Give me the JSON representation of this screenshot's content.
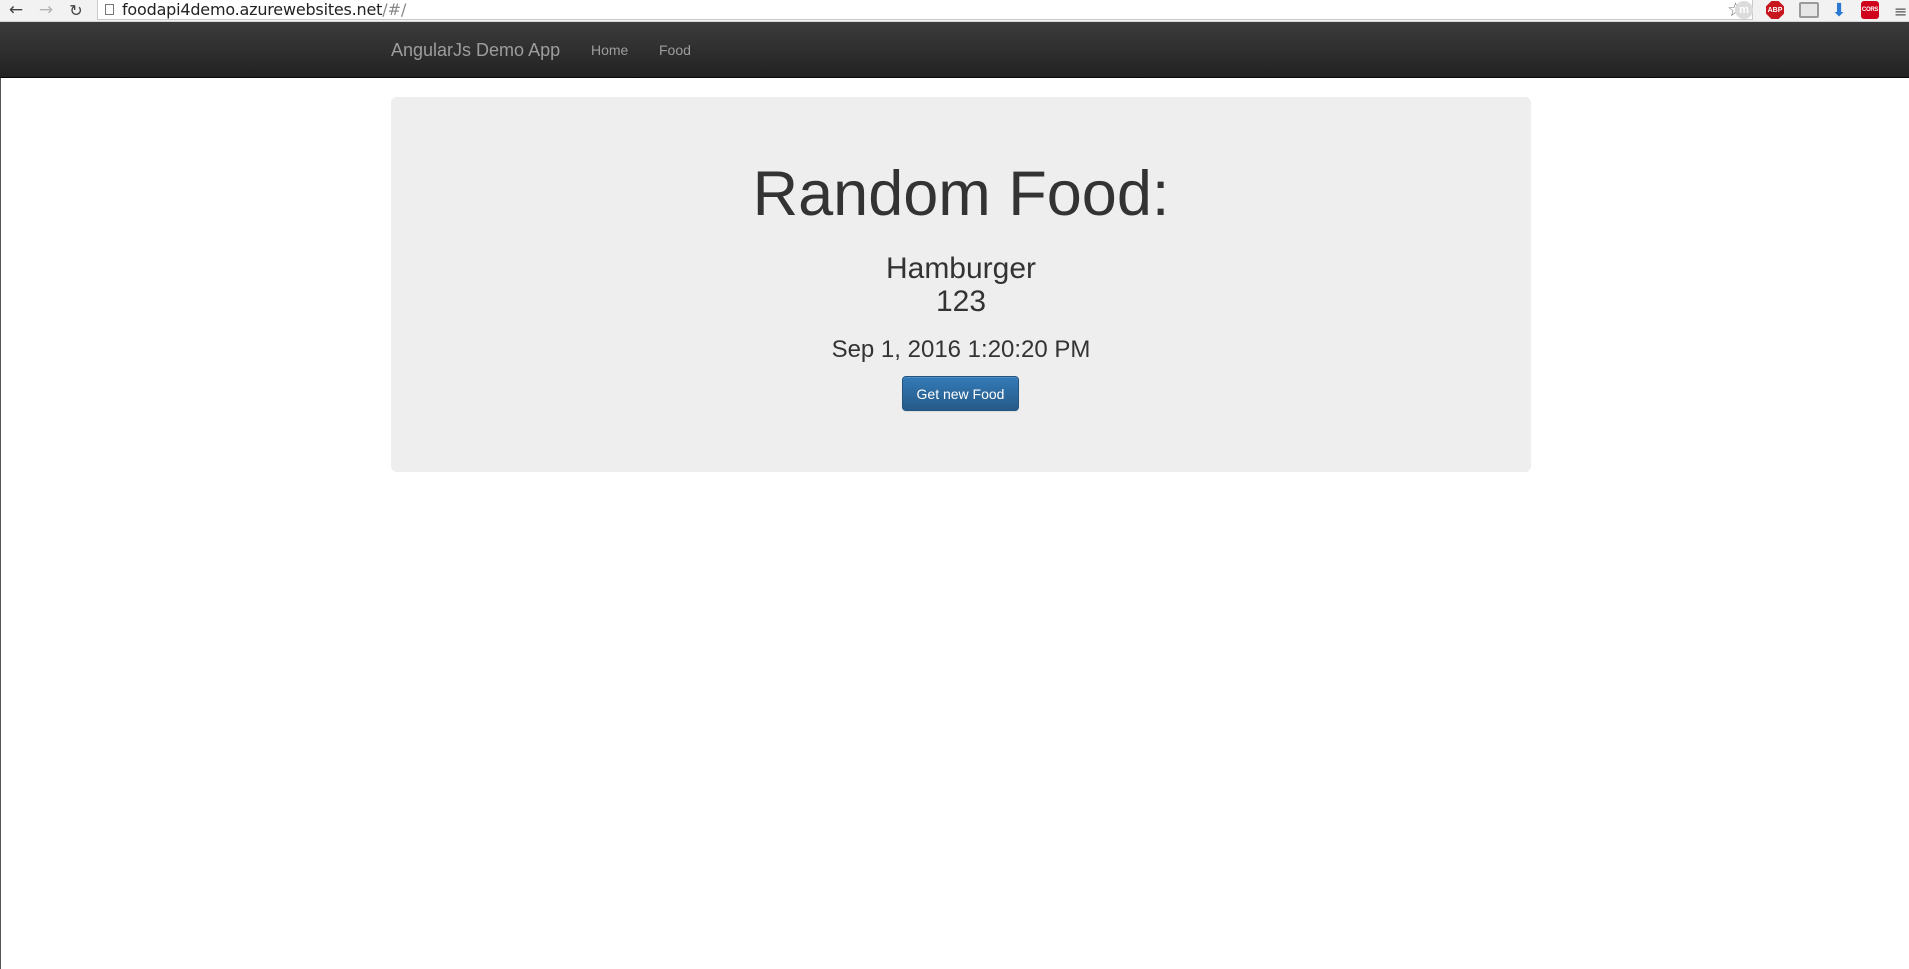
{
  "browser": {
    "url_host": "foodapi4demo.azurewebsites.net",
    "url_path": "/#/",
    "icons": [
      "back-icon",
      "forward-icon",
      "reload-icon",
      "page-icon",
      "star-icon",
      "extension-m-icon",
      "adblock-icon",
      "cast-icon",
      "download-icon",
      "cors-icon",
      "menu-icon"
    ],
    "ext_m_label": "m",
    "abp_label": "ABP",
    "cors_label": "CORS"
  },
  "navbar": {
    "brand": "AngularJs Demo App",
    "links": [
      {
        "label": "Home"
      },
      {
        "label": "Food"
      }
    ]
  },
  "main": {
    "title": "Random Food:",
    "food_name": "Hamburger",
    "food_number": "123",
    "timestamp": "Sep 1, 2016 1:20:20 PM",
    "button_label": "Get new Food"
  },
  "colors": {
    "navbar_bg": "#222222",
    "navbar_text": "#9d9d9d",
    "jumbotron_bg": "#eeeeee",
    "text": "#333333",
    "button_primary": "#337ab7"
  }
}
